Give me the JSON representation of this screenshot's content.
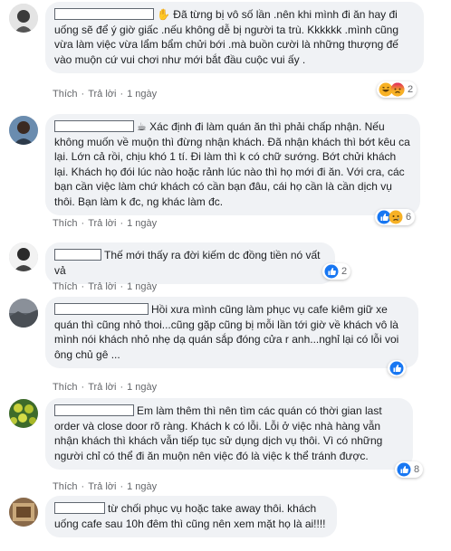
{
  "actions": {
    "like": "Thích",
    "reply": "Trả lời",
    "time": "1 ngày",
    "sep": "·"
  },
  "comments": [
    {
      "text": "Đã từng bị vô số lần .nên khi mình đi ăn hay đi uống sẽ để ý giờ giấc .nếu không dễ bị người ta trù. Kkkkkk .mình cũng vừa làm việc vừa lẩm bẩm chửi bới .mà buồn cười là những thượng đế vào muộn cứ vui chơi như mới bắt đầu cuộc vui ấy .",
      "reactions": {
        "icons": [
          "haha-icon",
          "angry-icon"
        ],
        "count": "2"
      }
    },
    {
      "text": "Xác định đi làm quán ăn thì phải chấp nhận. Nếu không muốn về muộn thì đừng nhận khách. Đã nhận khách thì bớt kêu ca lại. Lớn cả rồi, chịu khó 1 tí. Đi làm thì k có chữ sướng. Bớt chửi khách lại. Khách họ đói lúc nào hoặc rảnh lúc nào thì họ mới đi ăn. Với cra, các bạn cần việc làm chứ khách có cần bạn đâu, cái họ cần là cần dịch vụ thôi. Bạn làm k đc, ng khác làm đc.",
      "reactions": {
        "icons": [
          "like-icon",
          "sad-icon"
        ],
        "count": "6"
      }
    },
    {
      "text": "Thế mới thấy ra đời kiếm dc đồng tiền nó vất vả",
      "reactions": {
        "icons": [
          "like-icon"
        ],
        "count": "2"
      }
    },
    {
      "text": "Hồi xưa mình cũng làm phục vụ cafe kiêm giữ xe quán thì cũng nhỏ thoi...cũng gặp cũng bị mỗi lần tới giờ về khách vô là mình nói khách nhỏ nhẹ dạ quán sắp đóng cửa r anh...nghỉ lại có lỗi voi ông chủ gê ...",
      "reactions": {
        "icons": [
          "like-icon"
        ],
        "count": ""
      }
    },
    {
      "text": "Em làm thêm thì nên tìm các quán có thời gian last order và close door rõ ràng. Khách k có lỗi. Lỗi ở việc nhà hàng vẫn nhận khách thì khách vẫn tiếp tục sử dụng dịch vụ thôi. Vì có những người chỉ có thể đi ăn muộn nên việc đó là việc k thể tránh được.",
      "reactions": {
        "icons": [
          "like-icon"
        ],
        "count": "8"
      }
    },
    {
      "text": "từ chối phục vụ hoặc take away thôi. khách uống cafe sau 10h đêm thì cũng nên xem mặt họ là ai!!!!",
      "reactions": {
        "icons": [],
        "count": ""
      }
    }
  ]
}
